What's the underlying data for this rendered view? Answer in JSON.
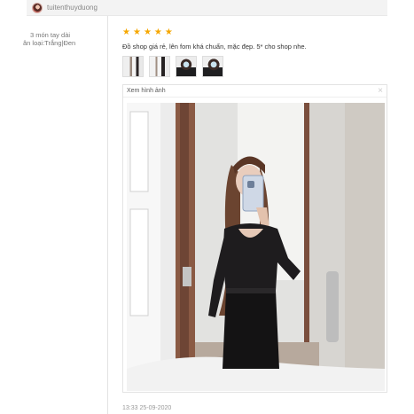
{
  "review": {
    "username": "tuitenthuyduong",
    "variant_line1": "3 món tay dài",
    "variant_line2": "ân loại:Trắng|Đen",
    "rating": 5,
    "comment": "Đồ shop giá rẻ, lên fom khá chuẩn, mặc đẹp. 5* cho shop nhe.",
    "thumbnails": [
      "photo-1",
      "photo-2",
      "photo-3",
      "photo-4"
    ],
    "viewer_title": "Xem hình ảnh",
    "close_symbol": "×",
    "timestamp": "13:33 25-09-2020"
  },
  "colors": {
    "star": "#f6a700",
    "muted_text": "#888888",
    "border": "#e3e3e3"
  },
  "icons": {
    "star": "star-icon",
    "close": "close-icon",
    "avatar": "avatar"
  }
}
